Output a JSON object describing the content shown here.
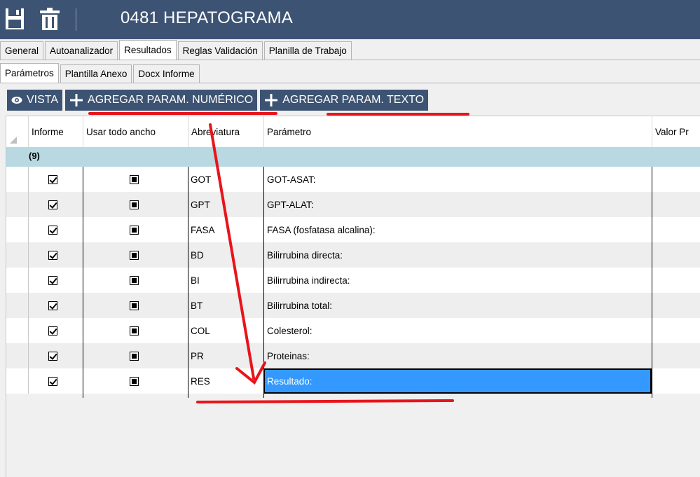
{
  "header": {
    "title": "0481  HEPATOGRAMA",
    "icons": [
      "save-icon",
      "trash-icon"
    ],
    "bg_color": "#3d5373"
  },
  "tabs_main": [
    "General",
    "Autoanalizador",
    "Resultados",
    "Reglas Validación",
    "Planilla de Trabajo"
  ],
  "tabs_main_active": "Resultados",
  "tabs_sub": [
    "Parámetros",
    "Plantilla Anexo",
    "Docx Informe"
  ],
  "tabs_sub_active": "Parámetros",
  "toolbar": {
    "vista_label": "VISTA",
    "add_numeric_label": "AGREGAR PARAM. NUMÉRICO",
    "add_text_label": "AGREGAR PARAM. TEXTO"
  },
  "grid": {
    "columns": [
      "Informe",
      "Usar todo ancho",
      "Abreviatura",
      "Parámetro",
      "Valor Pr"
    ],
    "group_label": "(9)",
    "rows": [
      {
        "informe": true,
        "usar_todo_ancho": true,
        "abreviatura": "GOT",
        "parametro": "GOT-ASAT:"
      },
      {
        "informe": true,
        "usar_todo_ancho": true,
        "abreviatura": "GPT",
        "parametro": "GPT-ALAT:"
      },
      {
        "informe": true,
        "usar_todo_ancho": true,
        "abreviatura": "FASA",
        "parametro": "FASA (fosfatasa alcalina):"
      },
      {
        "informe": true,
        "usar_todo_ancho": true,
        "abreviatura": "BD",
        "parametro": "Bilirrubina directa:"
      },
      {
        "informe": true,
        "usar_todo_ancho": true,
        "abreviatura": "BI",
        "parametro": "Bilirrubina indirecta:"
      },
      {
        "informe": true,
        "usar_todo_ancho": true,
        "abreviatura": "BT",
        "parametro": "Bilirrubina total:"
      },
      {
        "informe": true,
        "usar_todo_ancho": true,
        "abreviatura": "COL",
        "parametro": "Colesterol:"
      },
      {
        "informe": true,
        "usar_todo_ancho": true,
        "abreviatura": "PR",
        "parametro": "Proteinas:"
      },
      {
        "informe": true,
        "usar_todo_ancho": true,
        "abreviatura": "RES",
        "parametro": "Resultado:"
      }
    ],
    "selected_row": 8,
    "selected_color": "#3399ff",
    "group_color": "#b8d8e2"
  },
  "annotation_color": "#e8141b"
}
